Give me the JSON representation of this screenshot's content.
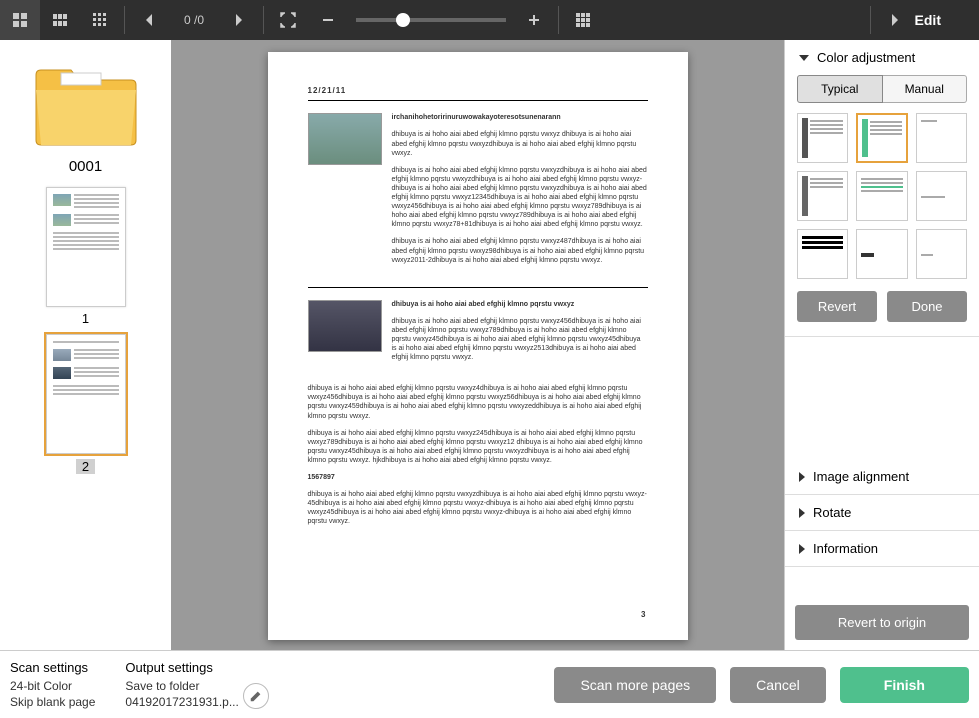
{
  "toolbar": {
    "page_display": "0 /0",
    "edit_label": "Edit"
  },
  "left": {
    "folder_name": "0001",
    "thumbs": [
      {
        "label": "1",
        "selected": false
      },
      {
        "label": "2",
        "selected": true
      }
    ]
  },
  "document": {
    "date": "12/21/11",
    "page_number": "3",
    "heading1": "irchanihohetoririnuruwowakayoteresotsunenarann",
    "section2_title": "dhibuya is ai hoho aiai abed efghij klmno pqrstu vwxyz",
    "code": "1567897",
    "paras": [
      "dhibuya is ai hoho aiai abed efghij klmno pqrstu vwxyz dhibuya is ai hoho aiai abed efghij klmno pqrstu vwxyzdhibuya is ai hoho aiai abed efghij klmno pqrstu vwxyz.",
      "dhibuya is ai hoho aiai abed efghij klmno pqrstu vwxyzdhibuya is ai hoho aiai abed efghij klmno pqrstu vwxyzdhibuya is ai hoho aiai abed efghij klmno pqrstu vwxyz-dhibuya is ai hoho aiai abed efghij klmno pqrstu vwxyzdhibuya is ai hoho aiai abed efghij klmno pqrstu vwxyz12345dhibuya is ai hoho aiai abed efghij klmno pqrstu vwxyz456dhibuya is ai hoho aiai abed efghij klmno pqrstu vwxyz789dhibuya is ai hoho aiai abed efghij klmno pqrstu vwxyz789dhibuya is ai hoho aiai abed efghij klmno pqrstu vwxyz78+81dhibuya is ai hoho aiai abed efghij klmno pqrstu vwxyz.",
      "dhibuya is ai hoho aiai abed efghij klmno pqrstu vwxyz487dhibuya is ai hoho aiai abed efghij klmno pqrstu vwxyz98dhibuya is ai hoho aiai abed efghij klmno pqrstu vwxyz2011-2dhibuya is ai hoho aiai abed efghij klmno pqrstu vwxyz.",
      "dhibuya is ai hoho aiai abed efghij klmno pqrstu vwxyz456dhibuya is ai hoho aiai abed efghij klmno pqrstu vwxyz789dhibuya is ai hoho aiai abed efghij klmno pqrstu vwxyz45dhibuya is ai hoho aiai abed efghij klmno pqrstu vwxyz45dhibuya is ai hoho aiai abed efghij klmno pqrstu vwxyz2513dhibuya is ai hoho aiai abed efghij klmno pqrstu vwxyz.",
      "dhibuya is ai hoho aiai abed efghij klmno pqrstu vwxyz4dhibuya is ai hoho aiai abed efghij klmno pqrstu vwxyz456dhibuya is ai hoho aiai abed efghij klmno pqrstu vwxyz56dhibuya is ai hoho aiai abed efghij klmno pqrstu vwxyz459dhibuya is ai hoho aiai abed efghij klmno pqrstu vwxyzeddhibuya is ai hoho aiai abed efghij klmno pqrstu vwxyz.",
      "dhibuya is ai hoho aiai abed efghij klmno pqrstu vwxyz245dhibuya is ai hoho aiai abed efghij klmno pqrstu vwxyz789dhibuya is ai hoho aiai abed efghij klmno pqrstu vwxyz12 dhibuya is ai hoho aiai abed efghij klmno pqrstu vwxyz45dhibuya is ai hoho aiai abed efghij klmno pqrstu vwxyzdhibuya is ai hoho aiai abed efghij klmno pqrstu vwxyz. hjkdhibuya is ai hoho aiai abed efghij klmno pqrstu vwxyz.",
      "dhibuya is ai hoho aiai abed efghij klmno pqrstu vwxyzdhibuya is ai hoho aiai abed efghij klmno pqrstu vwxyz-45dhibuya is ai hoho aiai abed efghij klmno pqrstu vwxyz-dhibuya is ai hoho aiai abed efghij klmno pqrstu vwxyz45dhibuya is ai hoho aiai abed efghij klmno pqrstu vwxyz-dhibuya is ai hoho aiai abed efghij klmno pqrstu vwxyz."
    ]
  },
  "right": {
    "color_adjustment": "Color adjustment",
    "tab_typical": "Typical",
    "tab_manual": "Manual",
    "revert": "Revert",
    "done": "Done",
    "image_alignment": "Image alignment",
    "rotate": "Rotate",
    "information": "Information",
    "revert_origin": "Revert to origin"
  },
  "bottom": {
    "scan_settings_hd": "Scan settings",
    "scan_line1": "24-bit Color",
    "scan_line2": "Skip blank page",
    "output_settings_hd": "Output settings",
    "out_line1": "Save to folder",
    "out_line2": "04192017231931.p...",
    "btn_scan_more": "Scan more pages",
    "btn_cancel": "Cancel",
    "btn_finish": "Finish"
  }
}
